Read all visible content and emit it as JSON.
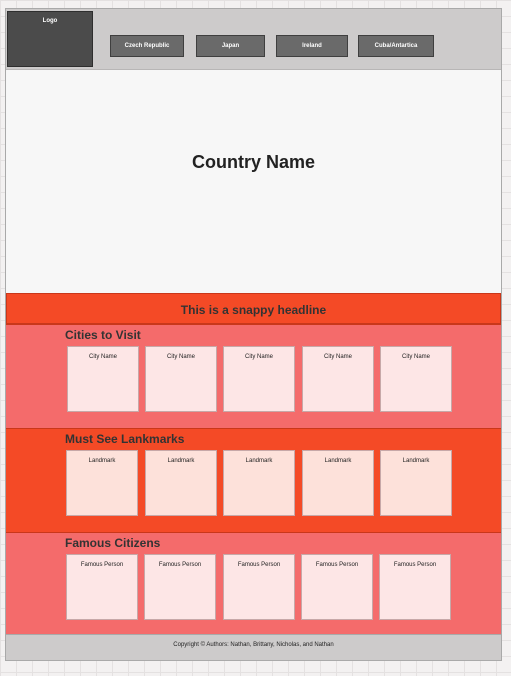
{
  "header": {
    "logo": "Logo",
    "nav": [
      "Czech Republic",
      "Japan",
      "Ireland",
      "Cuba/Antartica"
    ]
  },
  "hero": {
    "title": "Country Name"
  },
  "headline": "This is a snappy headline",
  "sections": [
    {
      "title": "Cities to Visit",
      "cards": [
        "City Name",
        "City Name",
        "City Name",
        "City Name",
        "City Name"
      ]
    },
    {
      "title": "Must See Lankmarks",
      "cards": [
        "Landmark",
        "Landmark",
        "Landmark",
        "Landmark",
        "Landmark"
      ]
    },
    {
      "title": "Famous Citizens",
      "cards": [
        "Famous Person",
        "Famous Person",
        "Famous Person",
        "Famous Person",
        "Famous Person"
      ]
    }
  ],
  "footer": {
    "text": "Copyright © Authors: Nathan, Brittany, Nicholas, and Nathan"
  },
  "colors": {
    "headline": "#f44a26",
    "section_pink": "#f46b6b",
    "card_pink": "#fde6e6",
    "card_peach": "#fde1da"
  }
}
